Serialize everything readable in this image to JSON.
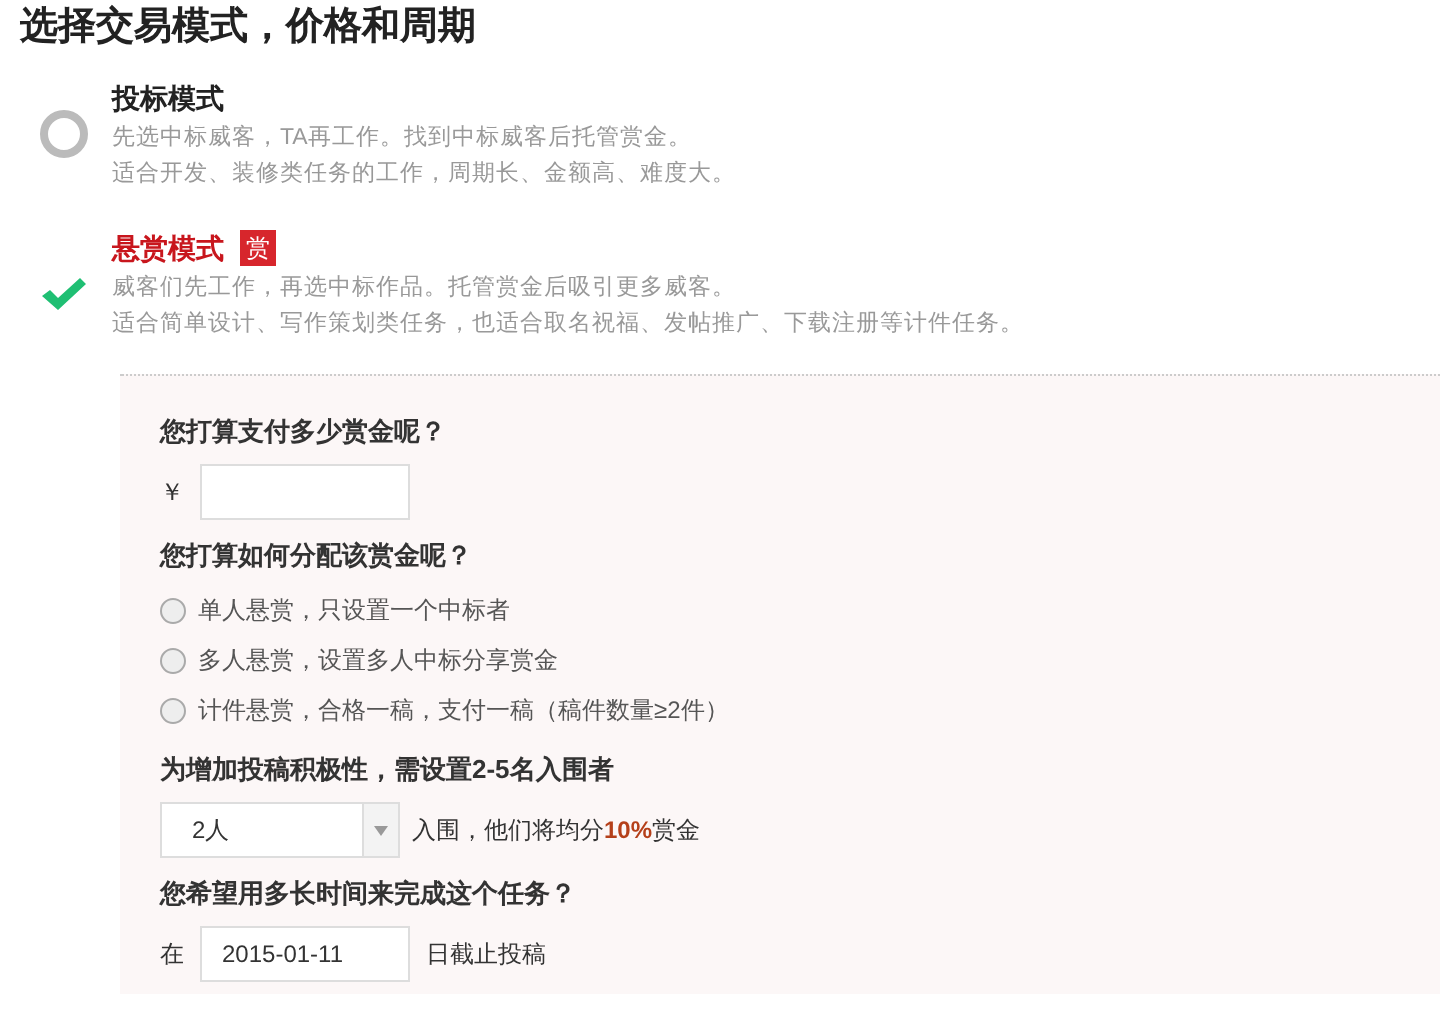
{
  "title": "选择交易模式，价格和周期",
  "modes": [
    {
      "name": "投标模式",
      "selected": false,
      "lines": [
        "先选中标威客，TA再工作。找到中标威客后托管赏金。",
        "适合开发、装修类任务的工作，周期长、金额高、难度大。"
      ]
    },
    {
      "name": "悬赏模式",
      "selected": true,
      "badge": "赏",
      "lines": [
        "威客们先工作，再选中标作品。托管赏金后吸引更多威客。",
        "适合简单设计、写作策划类任务，也适合取名祝福、发帖推广、下载注册等计件任务。"
      ]
    }
  ],
  "form": {
    "amount": {
      "label": "您打算支付多少赏金呢？",
      "currency": "￥"
    },
    "distribution": {
      "label": "您打算如何分配该赏金呢？",
      "options": [
        {
          "label": "单人悬赏，只设置一个中标者",
          "selected": false
        },
        {
          "label": "多人悬赏，设置多人中标分享赏金",
          "selected": false
        },
        {
          "label": "计件悬赏，合格一稿，支付一稿（稿件数量≥2件）",
          "selected": false
        }
      ]
    },
    "finalists": {
      "label": "为增加投稿积极性，需设置2-5名入围者",
      "value": "2人",
      "suffix": "入围，他们将均分**10%**赏金"
    },
    "deadline": {
      "label": "您希望用多长时间来完成这个任务？",
      "prefix": "在",
      "value": "2015-01-11",
      "suffix": "日截止投稿"
    }
  }
}
